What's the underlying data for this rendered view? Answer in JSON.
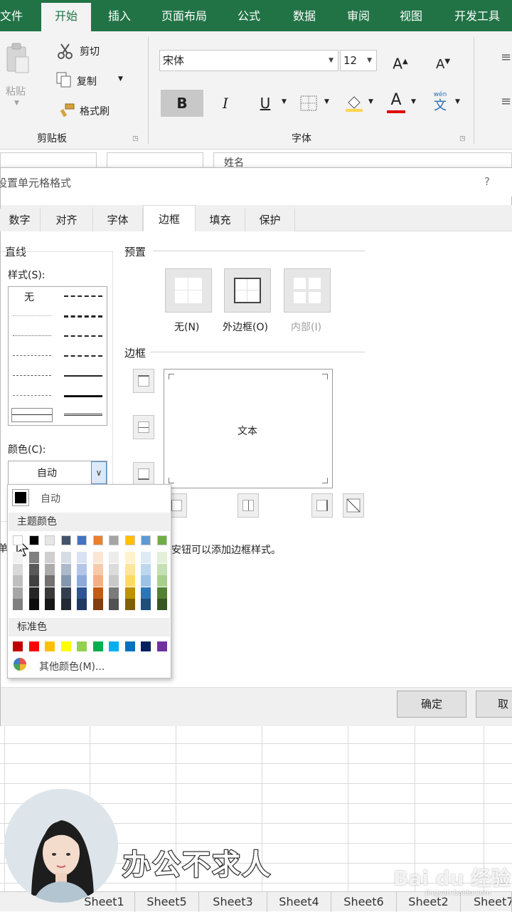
{
  "ribbon": {
    "tabs": [
      "文件",
      "开始",
      "插入",
      "页面布局",
      "公式",
      "数据",
      "审阅",
      "视图",
      "开发工具"
    ],
    "active_tab": "开始",
    "clipboard": {
      "paste": "粘贴",
      "cut": "剪切",
      "copy": "复制",
      "format_painter": "格式刷",
      "group": "剪贴板"
    },
    "font": {
      "name": "宋体",
      "size": "12",
      "bold": "B",
      "italic": "I",
      "underline": "U",
      "font_color": "A",
      "phonetic_top": "wén",
      "phonetic": "文",
      "group": "字体",
      "grow": "A",
      "shrink": "A"
    }
  },
  "formula_bar": {
    "name_fragment": "姓名"
  },
  "dialog": {
    "title": "设置单元格格式",
    "help": "?",
    "tabs": [
      "数字",
      "对齐",
      "字体",
      "边框",
      "填充",
      "保护"
    ],
    "active_tab": "边框",
    "line": {
      "section": "直线",
      "style_label": "样式(S):",
      "none_label": "无",
      "color_label": "颜色(C):",
      "color_value": "自动"
    },
    "presets": {
      "section": "预置",
      "items": [
        "无(N)",
        "外边框(O)",
        "内部(I)"
      ]
    },
    "border": {
      "section": "边框",
      "preview_text": "文本"
    },
    "hint_prefix": "单",
    "hint_text": "安钮可以添加边框样式。",
    "ok": "确定",
    "cancel": "取消"
  },
  "color_popup": {
    "automatic": "自动",
    "theme_header": "主题颜色",
    "standard_header": "标准色",
    "more_colors": "其他颜色(M)...",
    "theme_colors": [
      "#ffffff",
      "#000000",
      "#e7e6e6",
      "#44546a",
      "#4472c4",
      "#ed7d31",
      "#a5a5a5",
      "#ffc000",
      "#5b9bd5",
      "#70ad47"
    ],
    "theme_shades": [
      [
        "#f2f2f2",
        "#d9d9d9",
        "#bfbfbf",
        "#a6a6a6",
        "#808080"
      ],
      [
        "#808080",
        "#595959",
        "#404040",
        "#262626",
        "#0d0d0d"
      ],
      [
        "#d0cece",
        "#aeabab",
        "#757171",
        "#3b3838",
        "#171616"
      ],
      [
        "#d6dce4",
        "#adb9ca",
        "#8497b0",
        "#333f4f",
        "#222a35"
      ],
      [
        "#d9e2f3",
        "#b4c6e7",
        "#8eaadb",
        "#2f5496",
        "#1f3864"
      ],
      [
        "#fbe5d5",
        "#f7caac",
        "#f4b083",
        "#c55a11",
        "#833c0b"
      ],
      [
        "#ededed",
        "#dbdbdb",
        "#c9c9c9",
        "#7b7b7b",
        "#525252"
      ],
      [
        "#fff2cc",
        "#fee599",
        "#ffd965",
        "#bf9000",
        "#7f6000"
      ],
      [
        "#deebf6",
        "#bdd7ee",
        "#9cc3e5",
        "#2e75b5",
        "#1e4e79"
      ],
      [
        "#e2efd9",
        "#c5e0b3",
        "#a8d08d",
        "#538135",
        "#375623"
      ]
    ],
    "standard_colors": [
      "#c00000",
      "#ff0000",
      "#ffc000",
      "#ffff00",
      "#92d050",
      "#00b050",
      "#00b0f0",
      "#0070c0",
      "#002060",
      "#7030a0"
    ]
  },
  "sheets": [
    "Sheet1",
    "Sheet5",
    "Sheet3",
    "Sheet4",
    "Sheet6",
    "Sheet2",
    "Sheet7"
  ],
  "overlay": {
    "caption": "办公不求人",
    "watermark": "Bai du 经验",
    "watermark_url": "jingyan.baidu.com"
  }
}
